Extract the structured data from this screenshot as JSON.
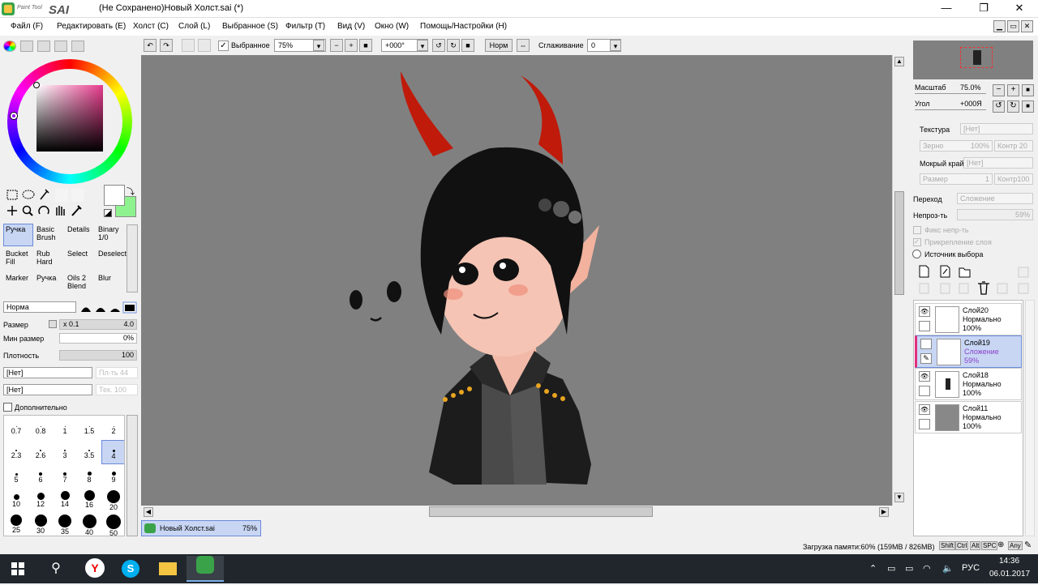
{
  "app": {
    "logo_text_small": "Paint Tool",
    "logo_text_big": "SAI",
    "window_title": "(Не Сохранено)Новый Холст.sai (*)"
  },
  "window_controls": {
    "minimize": "—",
    "restore": "❐",
    "close": "✕"
  },
  "menu": [
    "Файл (F)",
    "Редактировать (E)",
    "Холст (C)",
    "Слой (L)",
    "Выбранное (S)",
    "Фильтр (T)",
    "Вид (V)",
    "Окно (W)",
    "Помощь/Настройки (H)"
  ],
  "toolbar": {
    "selection_checkbox_label": "Выбранное",
    "zoom_value": "75%",
    "angle_value": "+000°",
    "normal_button": "Норм",
    "smoothing_label": "Сглаживание",
    "smoothing_value": "0"
  },
  "colors": {
    "primary_swatch": "#ffffff",
    "secondary_swatch": "#8ef28e",
    "accent": "#6b8bd8"
  },
  "tools": {
    "brushes": [
      {
        "label": "Ручка",
        "selected": true
      },
      {
        "label": "Basic Brush",
        "selected": false
      },
      {
        "label": "Details",
        "selected": false
      },
      {
        "label": "Binary 1/0",
        "selected": false
      },
      {
        "label": "Bucket Fill",
        "selected": false
      },
      {
        "label": "Rub Hard",
        "selected": false
      },
      {
        "label": "Select",
        "selected": false
      },
      {
        "label": "Deselect",
        "selected": false
      },
      {
        "label": "Marker",
        "selected": false
      },
      {
        "label": "Ручка",
        "selected": false
      },
      {
        "label": "Oils 2 Blend",
        "selected": false
      },
      {
        "label": "Blur",
        "selected": false
      }
    ]
  },
  "brush_settings": {
    "blend_mode": "Норма",
    "size_label": "Размер",
    "size_multiplier": "x 0.1",
    "size_value": "4.0",
    "min_size_label": "Мин размер",
    "min_size_value": "0%",
    "density_label": "Плотность",
    "density_value": "100",
    "texture_1": "[Нет]",
    "texture_1_value": "Пл-ть 44",
    "texture_2": "[Нет]",
    "texture_2_value": "Тек. 100",
    "advanced_label": "Дополнительно"
  },
  "brush_sizes": [
    "0.7",
    "0.8",
    "1",
    "1.5",
    "2",
    "2.3",
    "2.6",
    "3",
    "3.5",
    "4",
    "5",
    "6",
    "7",
    "8",
    "9",
    "10",
    "12",
    "14",
    "16",
    "20",
    "25",
    "30",
    "35",
    "40",
    "50"
  ],
  "selected_brush_size": "4",
  "navigator": {
    "zoom_label": "Масштаб",
    "zoom_value": "75.0%",
    "angle_label": "Угол",
    "angle_value": "+000Я"
  },
  "texture_panel": {
    "texture_label": "Текстура",
    "texture_value": "[Нет]",
    "grain_label": "Зерно",
    "grain_value": "100%",
    "contrast_label": "Контр",
    "contrast_value": "20",
    "wet_edge_label": "Мокрый край",
    "wet_edge_value": "[Нет]",
    "size_label": "Размер",
    "size_value": "1",
    "contrast2_label": "Контр",
    "contrast2_value": "100"
  },
  "layer_props": {
    "blend_label": "Переход",
    "blend_value": "Сложение",
    "opacity_label": "Непроз-ть",
    "opacity_value": "59%",
    "fix_opacity": "Фикс непр-ть",
    "clipping": "Прикрепление слоя",
    "selection_source": "Источник выбора"
  },
  "layers": [
    {
      "name": "Слой20",
      "mode": "Нормально",
      "opacity": "100%",
      "selected": false
    },
    {
      "name": "Слой19",
      "mode": "Сложение",
      "opacity": "59%",
      "selected": true
    },
    {
      "name": "Слой18",
      "mode": "Нормально",
      "opacity": "100%",
      "selected": false
    },
    {
      "name": "Слой11",
      "mode": "Нормально",
      "opacity": "100%",
      "selected": false
    }
  ],
  "canvas_tab": {
    "name": "Новый Холст.sai",
    "zoom": "75%"
  },
  "status": {
    "memory": "Загрузка памяти:60% (159MB / 826MB)",
    "keys": [
      "Shift",
      "Ctrl",
      "Alt",
      "SPC",
      "Any"
    ]
  },
  "taskbar": {
    "language": "РУС",
    "time": "14:36",
    "date": "06.01.2017"
  }
}
